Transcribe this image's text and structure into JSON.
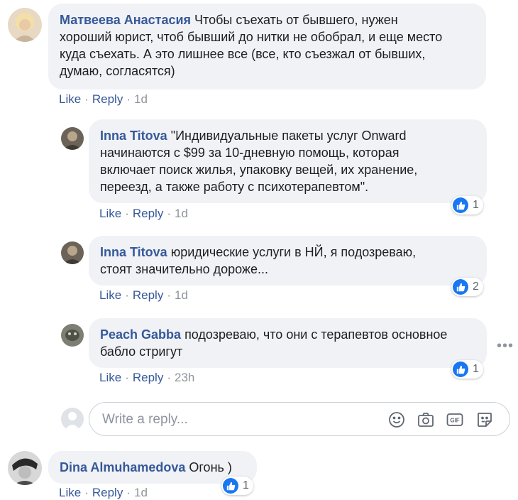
{
  "comments": [
    {
      "author": "Матвеева Анастасия",
      "text_lines": [
        "Чтобы съехать от бывшего, нужен",
        "хороший юрист, чтоб бывший до нитки не обобрал, и еще место",
        "куда съехать. А это лишнее все (все, кто съезжал от бывших,",
        "думаю, согласятся)"
      ],
      "actions": {
        "like": "Like",
        "reply": "Reply",
        "time": "1d"
      }
    },
    {
      "author": "Inna Titova",
      "text_lines": [
        "\"Индивидуальные пакеты услуг Onward",
        "начинаются с $99 за 10-дневную помощь, которая",
        "включает поиск жилья, упаковку вещей, их хранение,",
        "переезд, а также работу с психотерапевтом\"."
      ],
      "actions": {
        "like": "Like",
        "reply": "Reply",
        "time": "1d"
      },
      "reaction_count": "1"
    },
    {
      "author": "Inna Titova",
      "text_lines": [
        "юридические услуги в НЙ, я подозреваю,",
        "стоят значительно дороже..."
      ],
      "actions": {
        "like": "Like",
        "reply": "Reply",
        "time": "1d"
      },
      "reaction_count": "2"
    },
    {
      "author": "Peach Gabba",
      "text_lines": [
        "подозреваю, что они с терапевтов основное",
        "бабло стригут"
      ],
      "actions": {
        "like": "Like",
        "reply": "Reply",
        "time": "23h"
      },
      "reaction_count": "1"
    },
    {
      "author": "Dina Almuhamedova",
      "text_lines": [
        "Огонь )"
      ],
      "actions": {
        "like": "Like",
        "reply": "Reply",
        "time": "1d"
      },
      "reaction_count": "1"
    }
  ],
  "reply_box": {
    "placeholder": "Write a reply...",
    "tools": [
      "emoji-icon",
      "camera-icon",
      "gif-icon",
      "sticker-icon"
    ]
  },
  "more_options": "•••",
  "colors": {
    "link": "#365899",
    "bubble": "#f0f2f5",
    "like_blue": "#1877f2",
    "muted": "#90949c"
  }
}
